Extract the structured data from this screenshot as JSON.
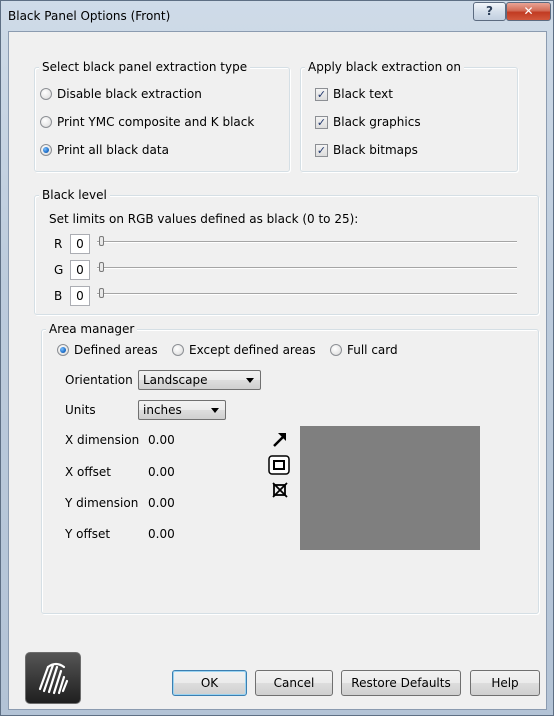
{
  "window": {
    "title": "Black Panel Options (Front)",
    "help_label": "?",
    "close_label": "✕"
  },
  "extraction_type": {
    "legend": "Select black panel extraction type",
    "options": [
      {
        "label": "Disable black extraction",
        "selected": false
      },
      {
        "label": "Print YMC composite and K black",
        "selected": false
      },
      {
        "label": "Print all black data",
        "selected": true
      }
    ]
  },
  "apply_on": {
    "legend": "Apply black extraction on",
    "options": [
      {
        "label": "Black text",
        "checked": true
      },
      {
        "label": "Black graphics",
        "checked": true
      },
      {
        "label": "Black bitmaps",
        "checked": true
      }
    ]
  },
  "black_level": {
    "legend": "Black level",
    "description": "Set limits on RGB values defined as black (0 to 25):",
    "channels": [
      {
        "label": "R",
        "value": "0"
      },
      {
        "label": "G",
        "value": "0"
      },
      {
        "label": "B",
        "value": "0"
      }
    ]
  },
  "area_manager": {
    "legend": "Area manager",
    "modes": [
      {
        "label": "Defined areas",
        "selected": true
      },
      {
        "label": "Except defined areas",
        "selected": false
      },
      {
        "label": "Full card",
        "selected": false
      }
    ],
    "orientation_label": "Orientation",
    "orientation_value": "Landscape",
    "units_label": "Units",
    "units_value": "inches",
    "fields": [
      {
        "label": "X dimension",
        "value": "0.00"
      },
      {
        "label": "X offset",
        "value": "0.00"
      },
      {
        "label": "Y dimension",
        "value": "0.00"
      },
      {
        "label": "Y offset",
        "value": "0.00"
      }
    ],
    "tools": [
      "arrow-select-icon",
      "rectangle-area-icon",
      "delete-area-icon"
    ]
  },
  "buttons": {
    "ok": "OK",
    "cancel": "Cancel",
    "restore_defaults": "Restore Defaults",
    "help": "Help"
  },
  "colors": {
    "preview_fill": "#7f7f7f",
    "accent": "#1f6fc9"
  }
}
